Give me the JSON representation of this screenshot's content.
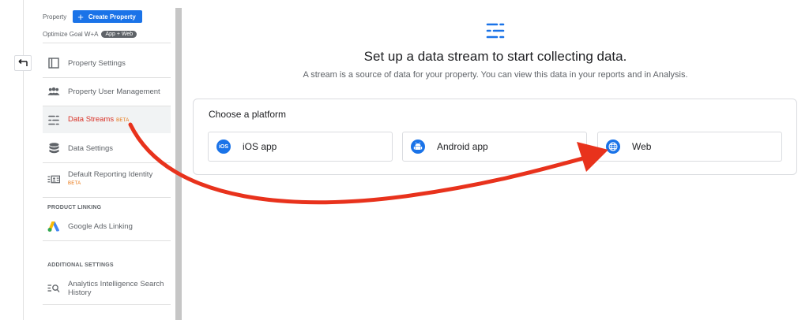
{
  "sidebar": {
    "property_label": "Property",
    "create_button": "Create Property",
    "goal_label": "Optimize Goal W+A",
    "goal_badge": "App + Web",
    "items": [
      {
        "label": "Property Settings",
        "icon": "property-settings-icon"
      },
      {
        "label": "Property User Management",
        "icon": "users-icon"
      },
      {
        "label": "Data Streams",
        "beta": "BETA",
        "icon": "data-streams-icon",
        "active": true
      },
      {
        "label": "Data Settings",
        "icon": "database-icon"
      },
      {
        "label": "Default Reporting Identity",
        "beta": "BETA",
        "icon": "identity-card-icon"
      }
    ],
    "product_linking_heading": "PRODUCT LINKING",
    "google_ads_label": "Google Ads Linking",
    "additional_settings_heading": "ADDITIONAL SETTINGS",
    "search_history_label": "Analytics Intelligence Search History"
  },
  "main": {
    "title": "Set up a data stream to start collecting data.",
    "subtitle": "A stream is a source of data for your property. You can view this data in your reports and in Analysis.",
    "platform_heading": "Choose a platform",
    "platforms": [
      {
        "label": "iOS app",
        "icon": "ios-icon",
        "icon_text": "iOS"
      },
      {
        "label": "Android app",
        "icon": "android-icon"
      },
      {
        "label": "Web",
        "icon": "globe-icon"
      }
    ]
  },
  "colors": {
    "accent": "#1a73e8",
    "active_text": "#d93025",
    "beta": "#e8710a",
    "annotation_arrow": "#e8321c"
  }
}
